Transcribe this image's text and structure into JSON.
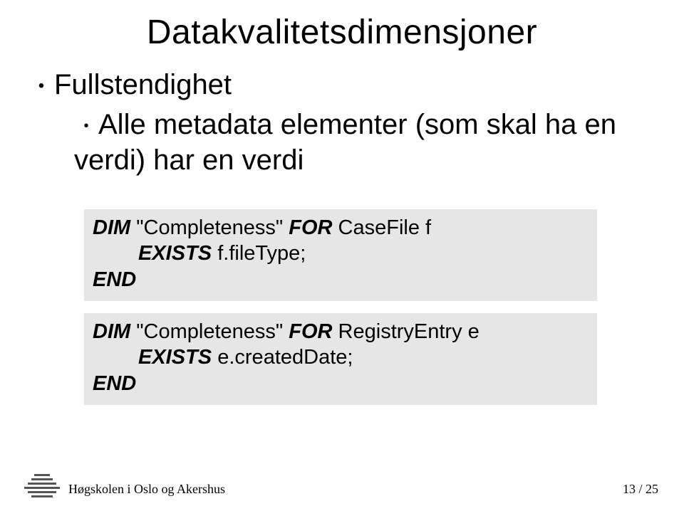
{
  "title": "Datakvalitetsdimensjoner",
  "bullets": {
    "l1": "Fullstendighet",
    "l2": "Alle metadata elementer (som skal ha en verdi) har en verdi"
  },
  "code1": {
    "dim": "DIM",
    "name": "\"Completeness\"",
    "for": "FOR",
    "target": "CaseFile f",
    "exists": "EXISTS",
    "expr": "f.fileType;",
    "end": "END"
  },
  "code2": {
    "dim": "DIM",
    "name": "\"Completeness\"",
    "for": "FOR",
    "target": "RegistryEntry e",
    "exists": "EXISTS",
    "expr": "e.createdDate;",
    "end": "END"
  },
  "footer": {
    "institution": "Høgskolen i Oslo og Akershus",
    "page": "13 / 25"
  }
}
